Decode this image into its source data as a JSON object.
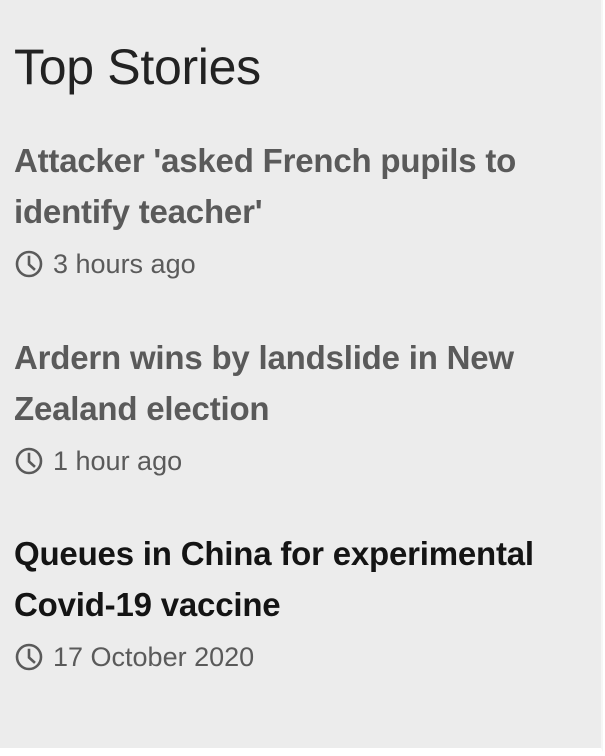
{
  "section": {
    "title": "Top Stories"
  },
  "stories": [
    {
      "headline_line1": "Attacker 'asked French pupils to",
      "headline_line2": "identify teacher'",
      "time": "3 hours ago"
    },
    {
      "headline_line1": "Ardern wins by landslide in New",
      "headline_line2": "Zealand election",
      "time": "1 hour ago"
    },
    {
      "headline_line1": "Queues in China for experimental",
      "headline_line2": "Covid-19 vaccine",
      "time": "17 October 2020"
    }
  ],
  "icons": {
    "timestamp": "clock-icon"
  },
  "colors": {
    "background": "#ececec",
    "visited_headline": "#5a5a5a",
    "unvisited_headline": "#141414",
    "meta_text": "#5a5a5a"
  }
}
